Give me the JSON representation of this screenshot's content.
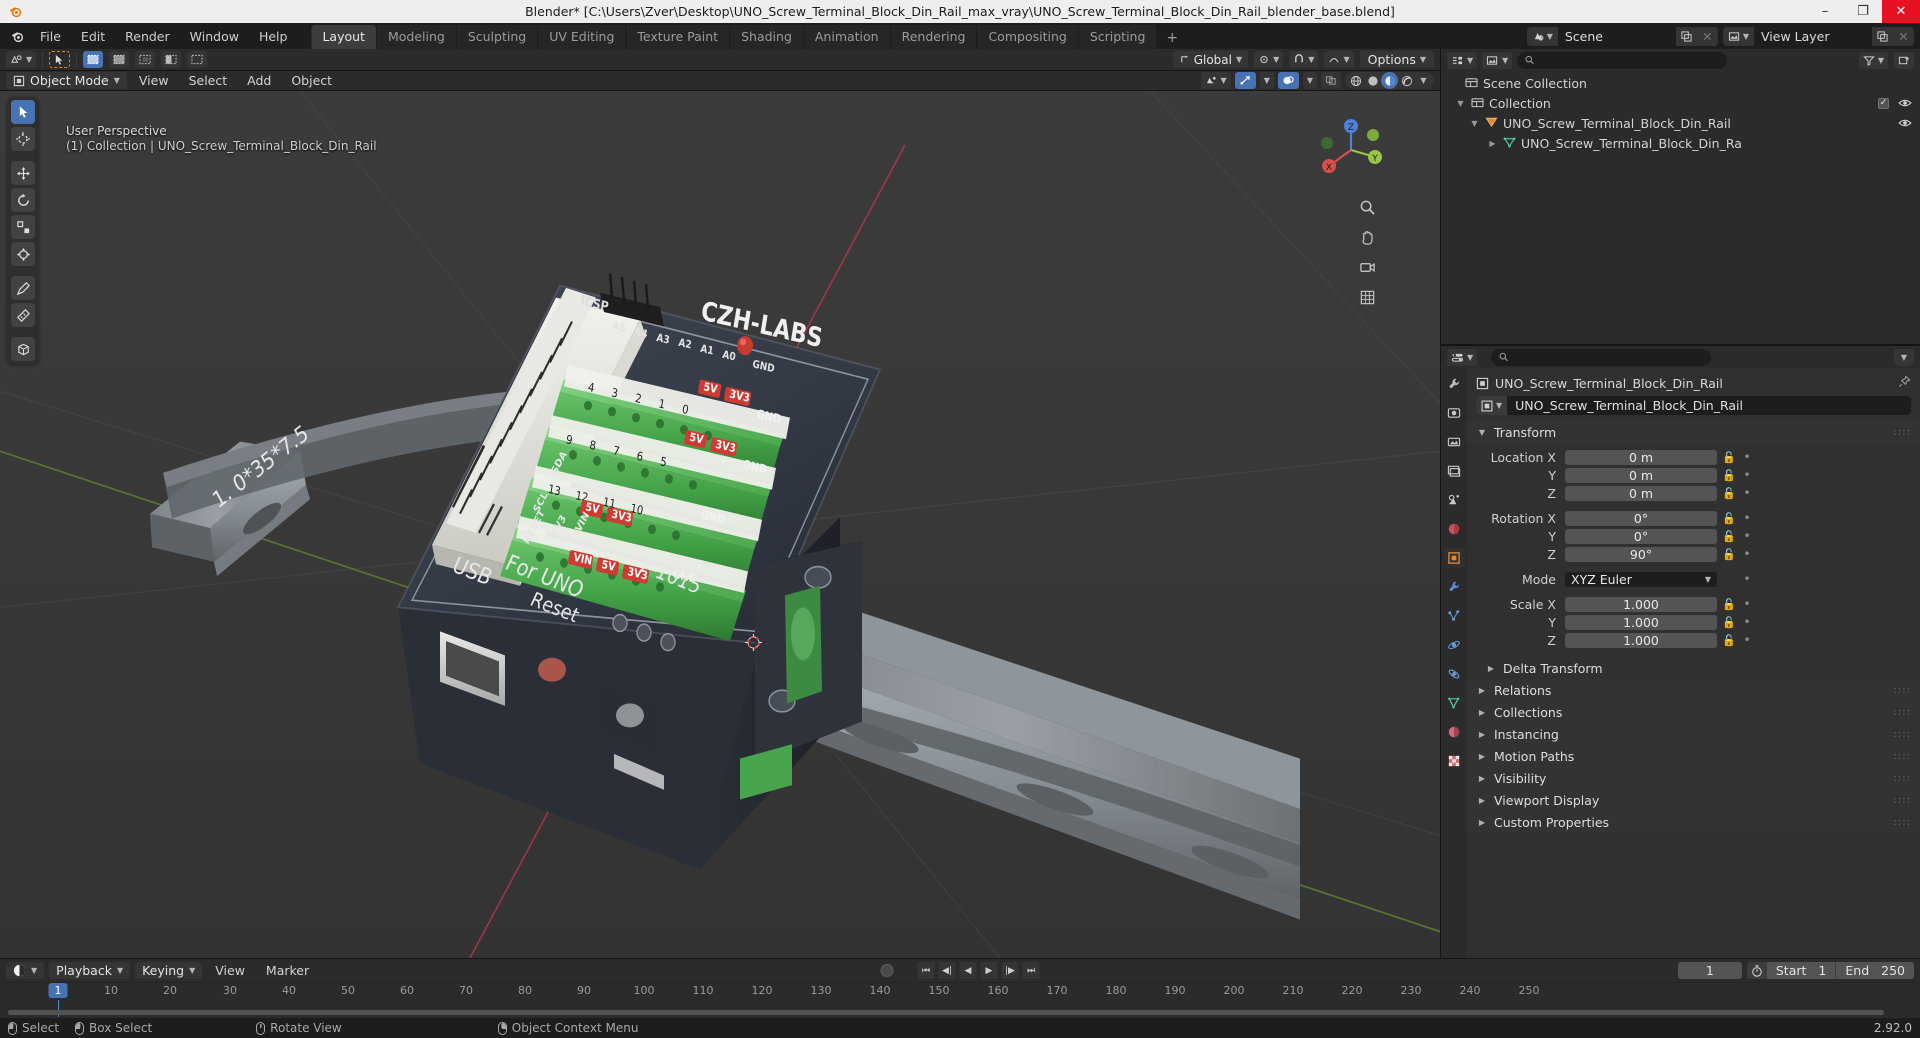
{
  "window": {
    "title": "Blender* [C:\\Users\\Zver\\Desktop\\UNO_Screw_Terminal_Block_Din_Rail_max_vray\\UNO_Screw_Terminal_Block_Din_Rail_blender_base.blend]",
    "minimize": "–",
    "maximize": "❐",
    "close": "✕"
  },
  "topbar": {
    "menus": [
      "File",
      "Edit",
      "Render",
      "Window",
      "Help"
    ],
    "workspaces": [
      {
        "label": "Layout",
        "active": true
      },
      {
        "label": "Modeling",
        "active": false
      },
      {
        "label": "Sculpting",
        "active": false
      },
      {
        "label": "UV Editing",
        "active": false
      },
      {
        "label": "Texture Paint",
        "active": false
      },
      {
        "label": "Shading",
        "active": false
      },
      {
        "label": "Animation",
        "active": false
      },
      {
        "label": "Rendering",
        "active": false
      },
      {
        "label": "Compositing",
        "active": false
      },
      {
        "label": "Scripting",
        "active": false
      }
    ],
    "add_workspace": "+",
    "scene_name": "Scene",
    "view_layer_name": "View Layer"
  },
  "viewport": {
    "toolbar_options_label": "Options",
    "transform_orientation": "Global",
    "mode": "Object Mode",
    "menus": [
      "View",
      "Select",
      "Add",
      "Object"
    ],
    "overlay_line1": "User Perspective",
    "overlay_line2": "(1) Collection | UNO_Screw_Terminal_Block_Din_Rail",
    "gizmo_axes": {
      "x": "X",
      "y": "Y",
      "z": "Z"
    },
    "gizmo_colors": {
      "x": "#d8504d",
      "y": "#97c64a",
      "z": "#4d82d8"
    }
  },
  "outliner": {
    "search_placeholder": "",
    "rows": [
      {
        "label": "Scene Collection",
        "indent": 0,
        "icon": "collection-icon",
        "expand": "",
        "checkbox": false,
        "eye": false
      },
      {
        "label": "Collection",
        "indent": 1,
        "icon": "collection-icon",
        "expand": "▼",
        "checkbox": true,
        "eye": true
      },
      {
        "label": "UNO_Screw_Terminal_Block_Din_Rail",
        "indent": 2,
        "icon": "object-icon",
        "expand": "▼",
        "checkbox": false,
        "eye": true
      },
      {
        "label": "UNO_Screw_Terminal_Block_Din_Ra",
        "indent": 3,
        "icon": "mesh-icon",
        "expand": "▶",
        "checkbox": false,
        "eye": false
      }
    ]
  },
  "properties": {
    "breadcrumb_object": "UNO_Screw_Terminal_Block_Din_Rail",
    "object_name_field": "UNO_Screw_Terminal_Block_Din_Rail",
    "transform_title": "Transform",
    "fields": [
      {
        "label": "Location X",
        "value": "0 m"
      },
      {
        "label": "Y",
        "value": "0 m"
      },
      {
        "label": "Z",
        "value": "0 m"
      },
      {
        "label": "Rotation X",
        "value": "0°"
      },
      {
        "label": "Y",
        "value": "0°"
      },
      {
        "label": "Z",
        "value": "90°"
      }
    ],
    "mode_label": "Mode",
    "mode_value": "XYZ Euler",
    "scale": [
      {
        "label": "Scale X",
        "value": "1.000"
      },
      {
        "label": "Y",
        "value": "1.000"
      },
      {
        "label": "Z",
        "value": "1.000"
      }
    ],
    "delta_transform": "Delta Transform",
    "panels": [
      "Relations",
      "Collections",
      "Instancing",
      "Motion Paths",
      "Visibility",
      "Viewport Display",
      "Custom Properties"
    ]
  },
  "timeline": {
    "playback": "Playback",
    "keying": "Keying",
    "view": "View",
    "marker": "Marker",
    "current_frame": "1",
    "start_label": "Start",
    "start_value": "1",
    "end_label": "End",
    "end_value": "250",
    "ticks": [
      "1",
      "10",
      "20",
      "30",
      "40",
      "50",
      "60",
      "70",
      "80",
      "90",
      "100",
      "110",
      "120",
      "130",
      "140",
      "150",
      "160",
      "170",
      "180",
      "190",
      "200",
      "210",
      "220",
      "230",
      "240",
      "250"
    ]
  },
  "statusbar": {
    "items": [
      {
        "icon": "mouse-left-icon",
        "label": "Select"
      },
      {
        "icon": "mouse-drag-icon",
        "label": "Box Select"
      },
      {
        "icon": "mouse-middle-icon",
        "label": "Rotate View"
      },
      {
        "icon": "mouse-right-icon",
        "label": "Object Context Menu"
      }
    ],
    "version": "2.92.0"
  }
}
